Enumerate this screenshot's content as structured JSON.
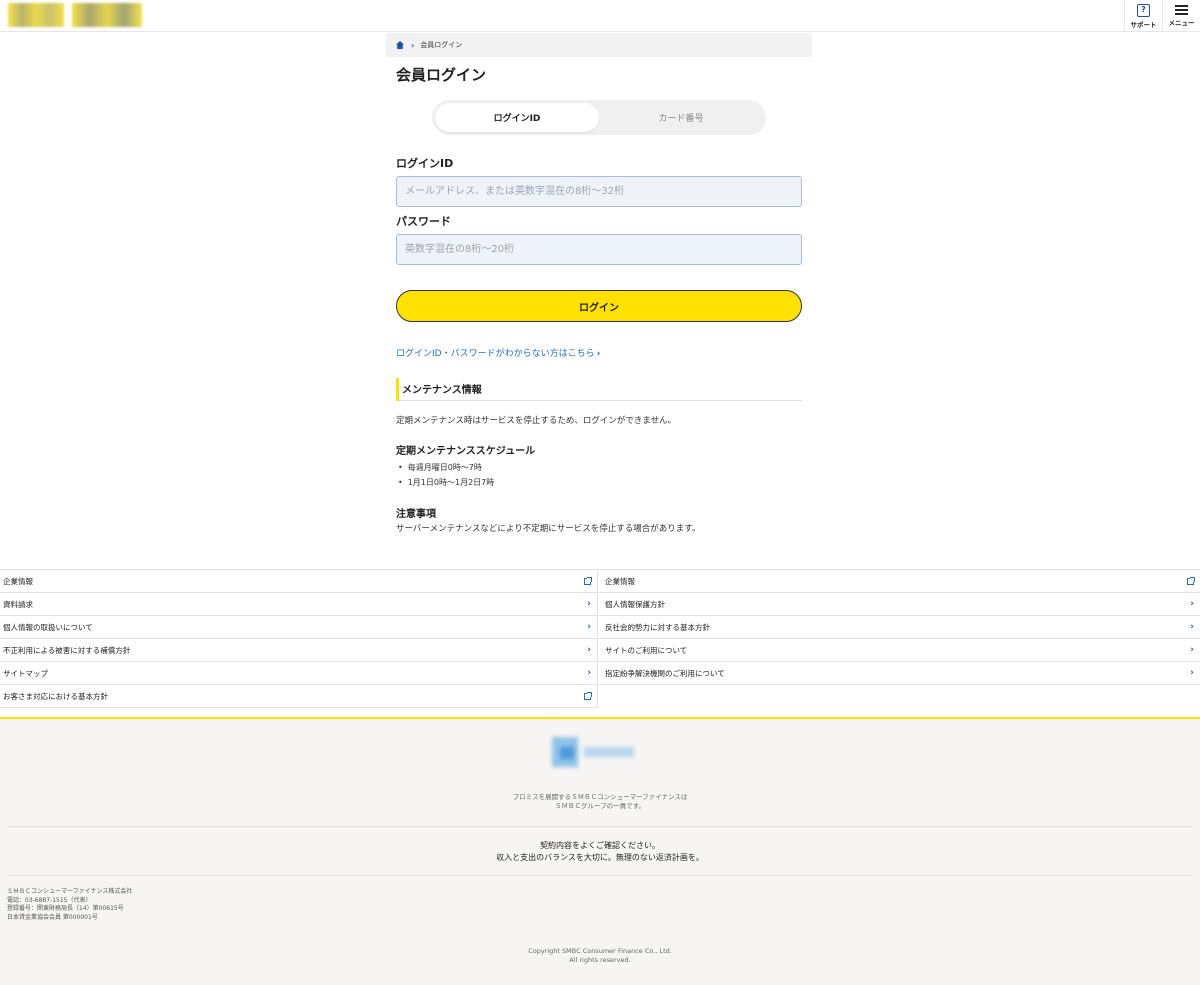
{
  "header": {
    "support_label": "サポート",
    "menu_label": "メニュー"
  },
  "breadcrumb": {
    "current": "会員ログイン"
  },
  "page_title": "会員ログイン",
  "tabs": [
    {
      "label": "ログインID",
      "active": true
    },
    {
      "label": "カード番号",
      "active": false
    }
  ],
  "form": {
    "login_id_label": "ログインID",
    "login_id_placeholder": "メールアドレス、または英数字混在の8桁～32桁",
    "password_label": "パスワード",
    "password_placeholder": "英数字混在の8桁～20桁",
    "login_button": "ログイン",
    "forgot_link": "ログインID・パスワードがわからない方はこちら"
  },
  "maintenance": {
    "title": "メンテナンス情報",
    "description": "定期メンテナンス時はサービスを停止するため、ログインができません。",
    "schedule_title": "定期メンテナンススケジュール",
    "schedule_items": [
      "毎週月曜日0時～7時",
      "1月1日0時～1月2日7時"
    ],
    "notes_title": "注意事項",
    "notes_text": "サーバーメンテナンスなどにより不定期にサービスを停止する場合があります。"
  },
  "footer_links_left": [
    {
      "label": "企業情報",
      "icon": "external-link-icon"
    },
    {
      "label": "資料請求",
      "icon": "chevron-right-icon"
    },
    {
      "label": "個人情報の取扱いについて",
      "icon": "chevron-right-icon"
    },
    {
      "label": "不正利用による被害に対する補償方針",
      "icon": "chevron-right-icon"
    },
    {
      "label": "サイトマップ",
      "icon": "chevron-right-icon"
    },
    {
      "label": "お客さま対応における基本方針",
      "icon": "external-link-icon"
    }
  ],
  "footer_links_right": [
    {
      "label": "企業情報",
      "icon": "external-link-icon"
    },
    {
      "label": "個人情報保護方針",
      "icon": "chevron-right-icon"
    },
    {
      "label": "反社会的勢力に対する基本方針",
      "icon": "chevron-right-icon"
    },
    {
      "label": "サイトのご利用について",
      "icon": "chevron-right-icon"
    },
    {
      "label": "指定紛争解決機関のご利用について",
      "icon": "chevron-right-icon"
    }
  ],
  "footer": {
    "group_line1": "プロミスを展開するＳＭＢＣコンシューマーファイナンスは",
    "group_line2": "ＳＭＢＣグループの一員です。",
    "notice_line1": "契約内容をよくご確認ください。",
    "notice_line2": "収入と支出のバランスを大切に。無理のない返済計画を。",
    "company_lines": [
      "ＳＭＢＣコンシューマーファイナンス株式会社",
      "電話：03-6887-1515（代表）",
      "登録番号：関東財務局長（14）第00615号",
      "日本貸金業協会会員 第000001号"
    ],
    "copyright1": "Copyright SMBC Consumer Finance Co., Ltd.",
    "copyright2": "All rights reserved."
  },
  "colors": {
    "accent_yellow": "#ffe100",
    "link_blue": "#1f6fc0",
    "brand_navy": "#1f4fa6"
  }
}
